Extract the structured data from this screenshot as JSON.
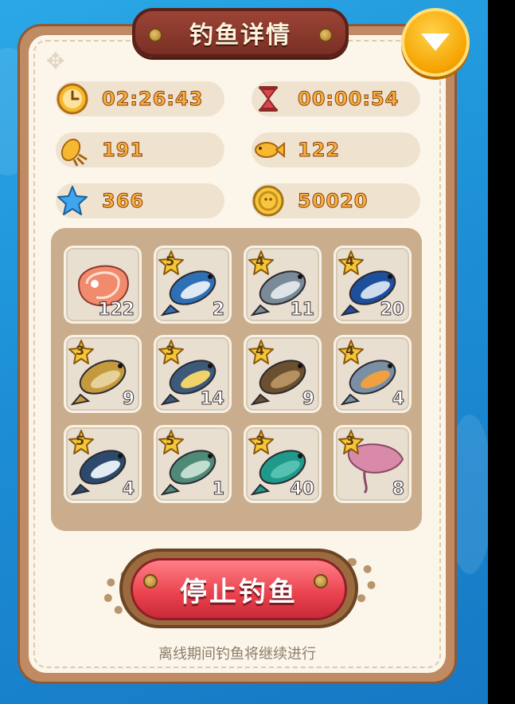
{
  "title": "钓鱼详情",
  "stats": {
    "online_time": "02:26:43",
    "remaining_time": "00:00:54",
    "bait": "191",
    "fish_caught": "122",
    "stars": "366",
    "coins": "50020"
  },
  "catches": [
    {
      "name": "salmon-steak",
      "stars": "",
      "count": "122"
    },
    {
      "name": "swordfish",
      "stars": "5",
      "count": "2"
    },
    {
      "name": "tuna",
      "stars": "4",
      "count": "11"
    },
    {
      "name": "marlin",
      "stars": "4",
      "count": "20"
    },
    {
      "name": "grouper",
      "stars": "3",
      "count": "9"
    },
    {
      "name": "bream",
      "stars": "3",
      "count": "14"
    },
    {
      "name": "rockfish",
      "stars": "4",
      "count": "9"
    },
    {
      "name": "perch",
      "stars": "4",
      "count": "4"
    },
    {
      "name": "shark",
      "stars": "5",
      "count": "4"
    },
    {
      "name": "sunfish",
      "stars": "5",
      "count": "1"
    },
    {
      "name": "parrotfish",
      "stars": "3",
      "count": "40"
    },
    {
      "name": "stingray",
      "stars": "3",
      "count": "8"
    }
  ],
  "stop_button": "停止钓鱼",
  "hint": "离线期间钓鱼将继续进行",
  "colors": {
    "accent_gold": "#f7b23b",
    "stop_red": "#e9414d",
    "panel": "#fbf5ea",
    "frame": "#c08a63"
  }
}
